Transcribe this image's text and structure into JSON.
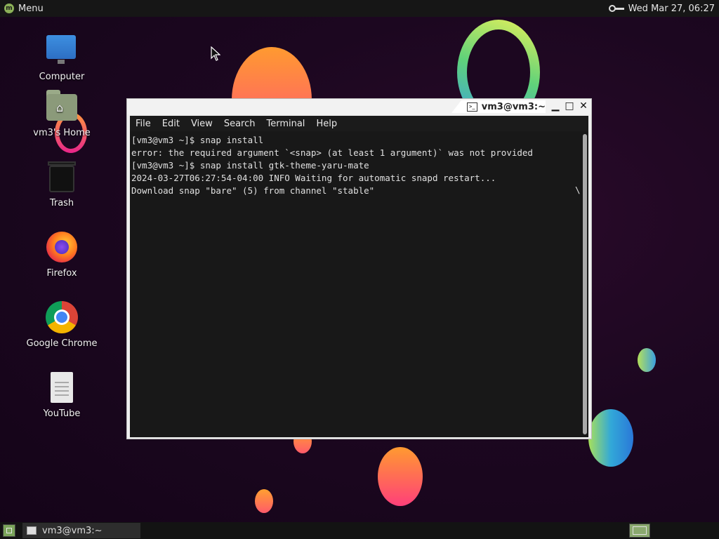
{
  "top_panel": {
    "menu_label": "Menu",
    "clock": "Wed Mar 27, 06:27"
  },
  "desktop_icons": [
    {
      "label": "Computer",
      "icon": "computer-icon"
    },
    {
      "label": "vm3's Home",
      "icon": "home-folder-icon"
    },
    {
      "label": "Trash",
      "icon": "trash-icon"
    },
    {
      "label": "Firefox",
      "icon": "firefox-icon"
    },
    {
      "label": "Google Chrome",
      "icon": "chrome-icon"
    },
    {
      "label": "YouTube",
      "icon": "document-icon"
    }
  ],
  "terminal": {
    "title": "vm3@vm3:~",
    "menu": [
      "File",
      "Edit",
      "View",
      "Search",
      "Terminal",
      "Help"
    ],
    "lines": [
      "[vm3@vm3 ~]$ snap install",
      "error: the required argument `<snap> (at least 1 argument)` was not provided",
      "[vm3@vm3 ~]$ snap install gtk-theme-yaru-mate",
      "2024-03-27T06:27:54-04:00 INFO Waiting for automatic snapd restart...",
      "Download snap \"bare\" (5) from channel \"stable\""
    ],
    "spinner": "\\"
  },
  "taskbar": {
    "window_button_label": "vm3@vm3:~"
  },
  "colors": {
    "panel": "#161616",
    "terminal_bg": "#181818",
    "accent_green": "#8bb158"
  }
}
